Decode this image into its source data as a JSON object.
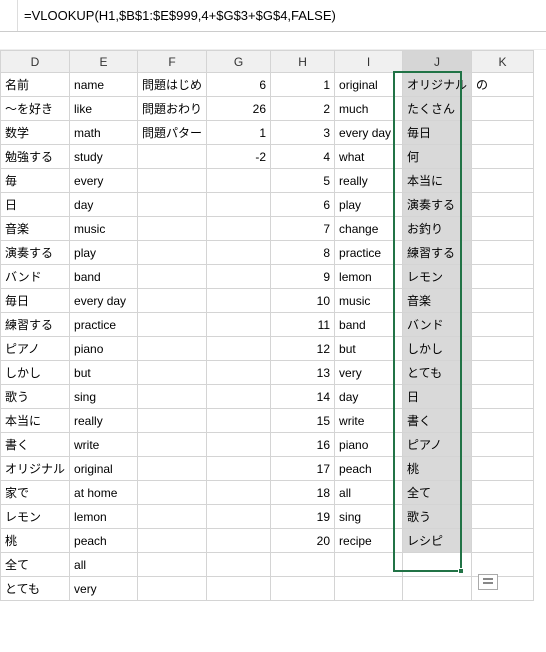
{
  "formula": "=VLOOKUP(H1,$B$1:$E$999,4+$G$3+$G$4,FALSE)",
  "headers": [
    "D",
    "E",
    "F",
    "G",
    "H",
    "I",
    "J",
    "K"
  ],
  "rows": [
    {
      "D": "名前",
      "E": "name",
      "F": "問題はじめ",
      "G": "6",
      "H": "1",
      "I": "original",
      "J": "オリジナル",
      "K": "の"
    },
    {
      "D": "～を好き",
      "E": "like",
      "F": "問題おわり",
      "G": "26",
      "H": "2",
      "I": "much",
      "J": "たくさん",
      "K": ""
    },
    {
      "D": "数学",
      "E": "math",
      "F": "問題パター",
      "G": "1",
      "H": "3",
      "I": "every day",
      "J": "毎日",
      "K": ""
    },
    {
      "D": "勉強する",
      "E": "study",
      "F": "",
      "G": "-2",
      "H": "4",
      "I": "what",
      "J": "何",
      "K": ""
    },
    {
      "D": "毎",
      "E": "every",
      "F": "",
      "G": "",
      "H": "5",
      "I": "really",
      "J": "本当に",
      "K": ""
    },
    {
      "D": "日",
      "E": "day",
      "F": "",
      "G": "",
      "H": "6",
      "I": "play",
      "J": "演奏する",
      "K": ""
    },
    {
      "D": "音楽",
      "E": "music",
      "F": "",
      "G": "",
      "H": "7",
      "I": "change",
      "J": "お釣り",
      "K": ""
    },
    {
      "D": "演奏する",
      "E": "play",
      "F": "",
      "G": "",
      "H": "8",
      "I": "practice",
      "J": "練習する",
      "K": ""
    },
    {
      "D": "バンド",
      "E": "band",
      "F": "",
      "G": "",
      "H": "9",
      "I": "lemon",
      "J": "レモン",
      "K": ""
    },
    {
      "D": "毎日",
      "E": "every day",
      "F": "",
      "G": "",
      "H": "10",
      "I": "music",
      "J": "音楽",
      "K": ""
    },
    {
      "D": "練習する",
      "E": "practice",
      "F": "",
      "G": "",
      "H": "11",
      "I": "band",
      "J": "バンド",
      "K": ""
    },
    {
      "D": "ピアノ",
      "E": "piano",
      "F": "",
      "G": "",
      "H": "12",
      "I": "but",
      "J": "しかし",
      "K": ""
    },
    {
      "D": "しかし",
      "E": "but",
      "F": "",
      "G": "",
      "H": "13",
      "I": "very",
      "J": "とても",
      "K": ""
    },
    {
      "D": "歌う",
      "E": "sing",
      "F": "",
      "G": "",
      "H": "14",
      "I": "day",
      "J": "日",
      "K": ""
    },
    {
      "D": "本当に",
      "E": "really",
      "F": "",
      "G": "",
      "H": "15",
      "I": "write",
      "J": "書く",
      "K": ""
    },
    {
      "D": "書く",
      "E": "write",
      "F": "",
      "G": "",
      "H": "16",
      "I": "piano",
      "J": "ピアノ",
      "K": ""
    },
    {
      "D": "オリジナル",
      "E": "original",
      "F": "",
      "G": "",
      "H": "17",
      "I": "peach",
      "J": "桃",
      "K": ""
    },
    {
      "D": "家で",
      "E": "at home",
      "F": "",
      "G": "",
      "H": "18",
      "I": "all",
      "J": "全て",
      "K": ""
    },
    {
      "D": "レモン",
      "E": "lemon",
      "F": "",
      "G": "",
      "H": "19",
      "I": "sing",
      "J": "歌う",
      "K": ""
    },
    {
      "D": "桃",
      "E": "peach",
      "F": "",
      "G": "",
      "H": "20",
      "I": "recipe",
      "J": "レシピ",
      "K": ""
    },
    {
      "D": "全て",
      "E": "all",
      "F": "",
      "G": "",
      "H": "",
      "I": "",
      "J": "",
      "K": ""
    },
    {
      "D": "とても",
      "E": "very",
      "F": "",
      "G": "",
      "H": "",
      "I": "",
      "J": "",
      "K": ""
    }
  ],
  "selection": {
    "col": "J",
    "startRow": 1,
    "endRow": 20
  }
}
